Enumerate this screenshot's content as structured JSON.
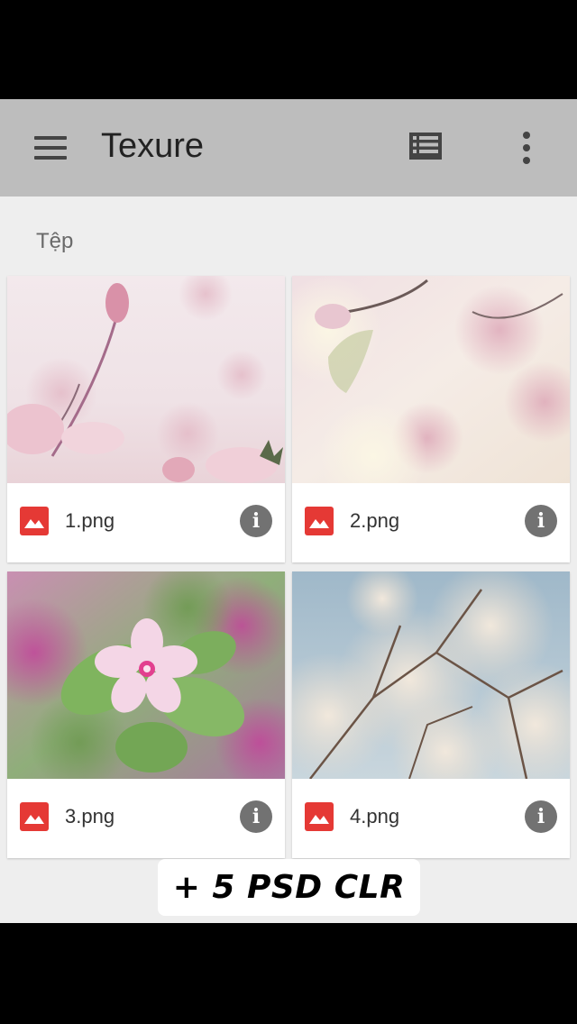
{
  "appbar": {
    "title": "Texure",
    "icons": [
      "menu-icon",
      "list-view-icon",
      "more-vert-icon"
    ]
  },
  "section_label": "Tệp",
  "files": [
    {
      "name": "1.png",
      "icon": "image-file-icon"
    },
    {
      "name": "2.png",
      "icon": "image-file-icon"
    },
    {
      "name": "3.png",
      "icon": "image-file-icon"
    },
    {
      "name": "4.png",
      "icon": "image-file-icon"
    }
  ],
  "info_glyph": "i",
  "overlay_badge": "+ 5 PSD CLR",
  "colors": {
    "appbar": "#bdbdbd",
    "background": "#eeeeee",
    "image_icon": "#e53935",
    "info_icon": "#727272"
  }
}
